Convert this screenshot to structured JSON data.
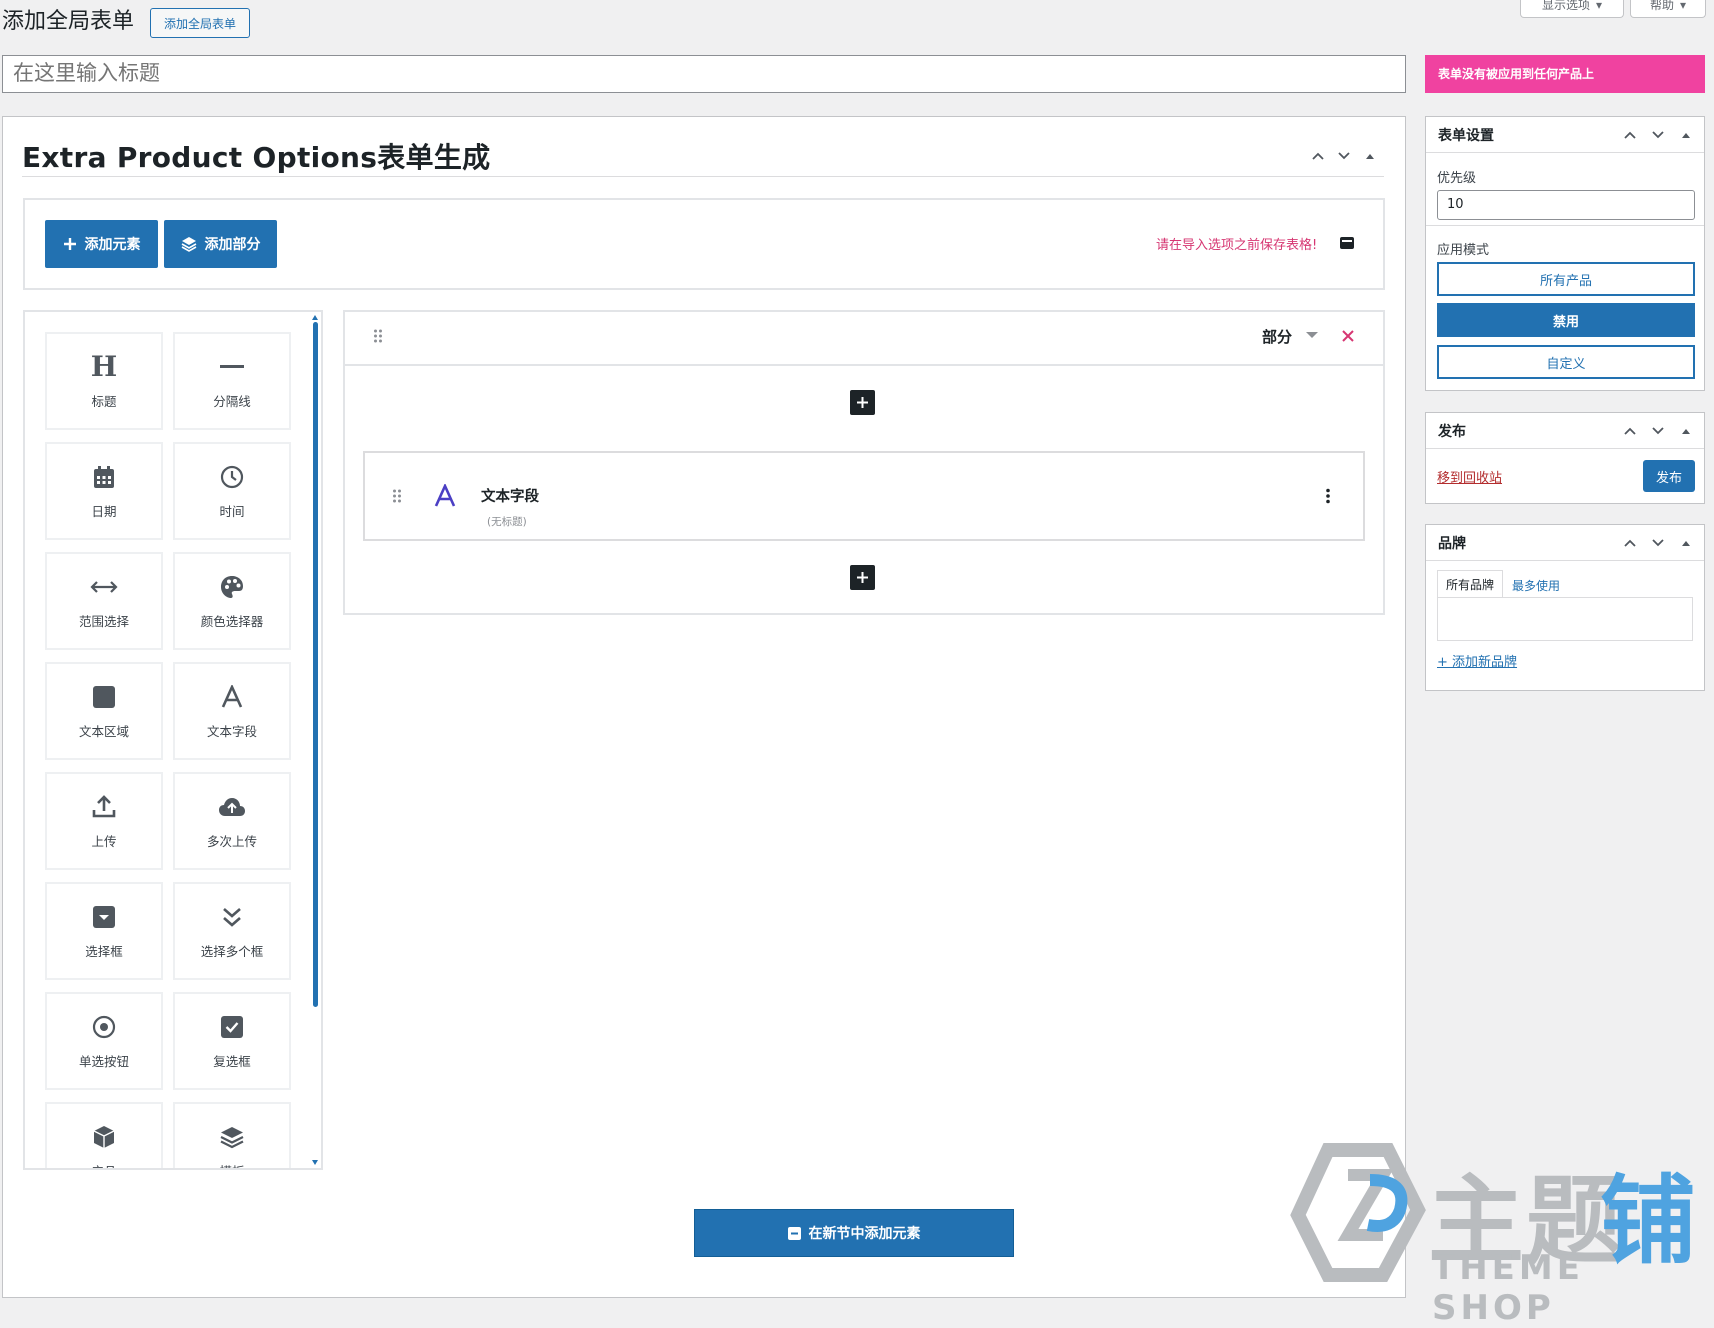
{
  "header": {
    "page_title": "添加全局表单",
    "add_new_label": "添加全局表单",
    "screen_options_label": "显示选项",
    "help_label": "帮助"
  },
  "title_input": {
    "placeholder": "在这里输入标题",
    "value": ""
  },
  "notice": {
    "text": "表单没有被应用到任何产品上"
  },
  "builder": {
    "title": "Extra Product Options表单生成",
    "add_element_label": "添加元素",
    "add_section_label": "添加部分",
    "warning": "请在导入选项之前保存表格!",
    "palette": [
      {
        "label": "标题",
        "icon": "heading-icon"
      },
      {
        "label": "分隔线",
        "icon": "divider-icon"
      },
      {
        "label": "日期",
        "icon": "calendar-icon"
      },
      {
        "label": "时间",
        "icon": "clock-icon"
      },
      {
        "label": "范围选择",
        "icon": "range-arrows-icon"
      },
      {
        "label": "颜色选择器",
        "icon": "palette-icon"
      },
      {
        "label": "文本区域",
        "icon": "textarea-icon"
      },
      {
        "label": "文本字段",
        "icon": "text-a-icon"
      },
      {
        "label": "上传",
        "icon": "upload-icon"
      },
      {
        "label": "多次上传",
        "icon": "cloud-upload-icon"
      },
      {
        "label": "选择框",
        "icon": "select-box-icon"
      },
      {
        "label": "选择多个框",
        "icon": "double-chevron-icon"
      },
      {
        "label": "单选按钮",
        "icon": "radio-icon"
      },
      {
        "label": "复选框",
        "icon": "checkbox-icon"
      },
      {
        "label": "产品",
        "icon": "product-cube-icon"
      },
      {
        "label": "模板",
        "icon": "layers-icon"
      }
    ],
    "section": {
      "label": "部分",
      "field": {
        "title": "文本字段",
        "subtitle": "(无标题)"
      }
    },
    "add_in_new_section_label": "在新节中添加元素"
  },
  "sidebar": {
    "form_settings": {
      "title": "表单设置",
      "priority_label": "优先级",
      "priority_value": "10",
      "mode_label": "应用模式",
      "modes": [
        "所有产品",
        "禁用",
        "自定义"
      ],
      "active_mode": "禁用"
    },
    "publish": {
      "title": "发布",
      "trash_label": "移到回收站",
      "publish_label": "发布"
    },
    "brand": {
      "title": "品牌",
      "tabs": [
        "所有品牌",
        "最多使用"
      ],
      "add_new_label": "+ 添加新品牌"
    }
  },
  "watermark": {
    "text_cn": "主题",
    "text_cn_accent": "铺",
    "text_en": "THEME SHOP"
  },
  "colors": {
    "primary": "#2271b1",
    "notice": "#f042a0",
    "warning_text": "#d63672",
    "close_x": "#d63672",
    "field_icon": "#4b3fc4"
  }
}
